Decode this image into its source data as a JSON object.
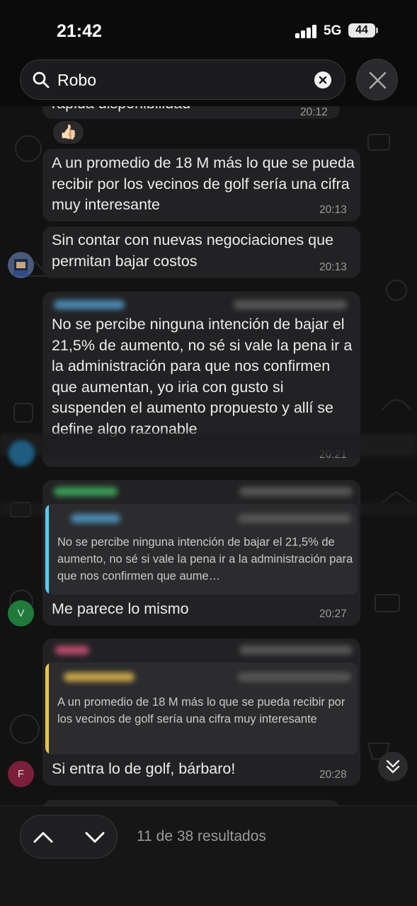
{
  "status_bar": {
    "time": "21:42",
    "network": "5G",
    "battery": "44"
  },
  "search": {
    "value": "Robo",
    "placeholder": ""
  },
  "messages": [
    {
      "text": "rápida disponibilidad",
      "time": "20:12",
      "reaction": "👍🏻"
    },
    {
      "text": "A un promedio de 18 M más lo que se pueda recibir por los vecinos de golf sería una cifra muy interesante",
      "time": "20:13"
    },
    {
      "text": "Sin contar con nuevas negociaciones que permitan bajar costos",
      "time": "20:13"
    },
    {
      "text": "No se percibe ninguna intención de bajar el 21,5% de aumento, no sé si vale la pena ir a la administración para que nos confirmen que aumentan, yo iria con gusto si suspenden el aumento propuesto y allí se define algo razonable",
      "time": "20:21"
    },
    {
      "quote": "No se percibe ninguna intención de bajar el 21,5% de aumento, no sé si vale la pena ir a la administración para que nos confirmen que aume…",
      "text": "Me parece lo mismo",
      "time": "20:27",
      "avatar": "V"
    },
    {
      "quote": "A un promedio de 18 M más lo que se pueda recibir por los vecinos de golf sería una cifra muy interesante",
      "text": "Si entra lo de golf, bárbaro!",
      "time": "20:28",
      "avatar": "F"
    }
  ],
  "footer": {
    "results": "11 de 38 resultados"
  },
  "colors": {
    "quote_blue": "#5ac8fa",
    "quote_yellow": "#e8c44a",
    "avatar_v": "#1f7a3c",
    "avatar_f": "#7a1f3a",
    "bubble": "#222224"
  }
}
